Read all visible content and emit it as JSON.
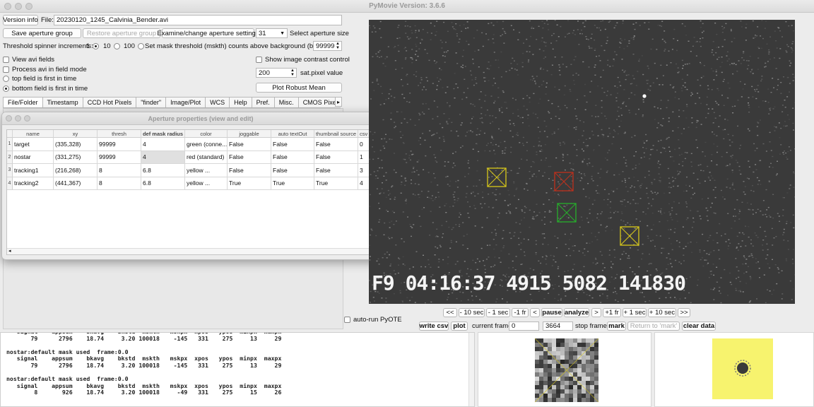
{
  "app": {
    "title": "PyMovie  Version: 3.6.6"
  },
  "toolbar": {
    "version_info_label": "Version info",
    "file_label": "File:",
    "file_value": "20230120_1245_Calvinia_Bender.avi",
    "save_aperture_group_label": "Save aperture group",
    "restore_aperture_group_label": "Restore aperture group",
    "examine_aperture_settings_label": "Examine/change aperture settings",
    "aperture_size_value": "31",
    "select_aperture_size_label": "Select aperture size",
    "threshold_spinner_label": "Threshold spinner increments:",
    "increment_1": "1",
    "increment_10": "10",
    "increment_100": "100",
    "mask_threshold_label": "Set mask threshold (mskth) counts above background (bkavg)",
    "mask_threshold_value": "99999",
    "view_avi_fields_label": "View avi fields",
    "process_field_mode_label": "Process avi in field mode",
    "top_field_first_label": "top field is first in time",
    "bottom_field_first_label": "bottom field is first in time",
    "show_contrast_control_label": "Show image contrast control",
    "sat_pixel_value": "200",
    "sat_pixel_label": "sat.pixel value",
    "plot_robust_mean_label": "Plot Robust Mean"
  },
  "tabs": [
    {
      "label": "File/Folder"
    },
    {
      "label": "Timestamp"
    },
    {
      "label": "CCD Hot Pixels"
    },
    {
      "label": "\"finder\""
    },
    {
      "label": "Image/Plot"
    },
    {
      "label": "WCS"
    },
    {
      "label": "Help"
    },
    {
      "label": "Pref."
    },
    {
      "label": "Misc."
    },
    {
      "label": "CMOS Pixe"
    }
  ],
  "dialog": {
    "title": "Aperture properties (view and edit)",
    "columns": [
      "name",
      "xy",
      "thresh",
      "def mask radius",
      "color",
      "joggable",
      "auto textOut",
      "thumbnail source",
      "csv output ord"
    ],
    "rows": [
      {
        "num": "1",
        "cells": [
          "target",
          "(335,328)",
          "99999",
          "4",
          "green (conne...",
          "False",
          "False",
          "False",
          "0"
        ]
      },
      {
        "num": "2",
        "cells": [
          "nostar",
          "(331,275)",
          "99999",
          "4",
          "red (standard)",
          "False",
          "False",
          "False",
          "1"
        ]
      },
      {
        "num": "3",
        "cells": [
          "tracking1",
          "(216,268)",
          "8",
          "6.8",
          "yellow ...",
          "False",
          "False",
          "False",
          "3"
        ]
      },
      {
        "num": "4",
        "cells": [
          "tracking2",
          "(441,367)",
          "8",
          "6.8",
          "yellow ...",
          "True",
          "True",
          "True",
          "4"
        ]
      }
    ]
  },
  "video": {
    "overlay_text": "F9 04:16:37 4915 5082 141830",
    "colors": {
      "yellow": "#d8c81a",
      "red": "#c0301c",
      "green": "#27b02b"
    }
  },
  "playback": {
    "buttons": [
      "<<",
      "- 10 sec",
      "- 1 sec",
      "-1 fr",
      "<",
      "pause",
      "analyze",
      ">",
      "+1 fr",
      "+ 1 sec",
      "+ 10 sec",
      ">>"
    ],
    "auto_run_pyote_label": "auto-run PyOTE",
    "write_csv_label": "write csv",
    "plot_label": "plot",
    "current_frame_label": "current frame",
    "current_frame_value": "0",
    "stop_frame_value": "3664",
    "stop_frame_label": "stop frame",
    "mark_label": "mark",
    "return_to_mark_label": "Return to 'mark'",
    "clear_data_label": "clear data"
  },
  "log": {
    "lines": [
      "   signal    appsum    bkavg    bkstd  mskth   mskpx  xpos   ypos  minpx  maxpx",
      "       79      2796    18.74     3.20 100018    -145   331    275     13     29",
      "",
      "nostar:default mask used  frame:0.0",
      "   signal    appsum    bkavg    bkstd  mskth   mskpx  xpos   ypos  minpx  maxpx",
      "       79      2796    18.74     3.20 100018    -145   331    275     13     29",
      "",
      "nostar:default mask used  frame:0.0",
      "   signal    appsum    bkavg    bkstd  mskth   mskpx  xpos   ypos  minpx  maxpx",
      "        8       926    18.74     3.20 100018     -49   331    275     15     26"
    ]
  },
  "thumbnails": {
    "thumb2_color": "#f7f36e"
  }
}
